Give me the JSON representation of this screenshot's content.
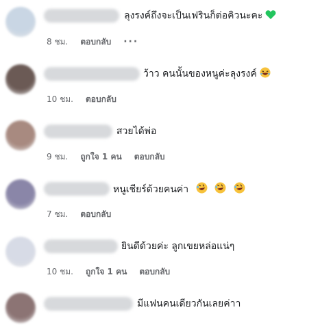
{
  "comments": [
    {
      "text": "ลุงรงค์ถึงจะเป็นเฟรินก็ต่อคิวนะคะ",
      "emoji": "green-heart",
      "time": "8 ชม.",
      "reply": "ตอบกลับ",
      "more": "···",
      "avatar_color": "#c9d6e4"
    },
    {
      "text": "ว้าว คนนั้นของหนูค่ะลุงรงค์",
      "emoji": "laughing-face",
      "time": "10 ชม.",
      "reply": "ตอบกลับ",
      "avatar_color": "#6b5a55"
    },
    {
      "text": "สวยได้พ่อ",
      "time": "9 ชม.",
      "like": "ถูกใจ 1 คน",
      "reply": "ตอบกลับ",
      "avatar_color": "#a88a80"
    },
    {
      "text": "หนูเชียร์ด้วยคนค่า",
      "emoji": "rofl-face",
      "time": "7 ชม.",
      "reply": "ตอบกลับ",
      "avatar_color": "#8a86a8"
    },
    {
      "text": "ยินดีด้วยค่ะ ลูกเขยหล่อแน่ๆ",
      "time": "10 ชม.",
      "like": "ถูกใจ 1 คน",
      "reply": "ตอบกลับ",
      "avatar_color": "#d7dbe6"
    },
    {
      "text": "มีแฟนคนเดียวกันเลยค่าา",
      "avatar_color": "#8c7474"
    }
  ]
}
